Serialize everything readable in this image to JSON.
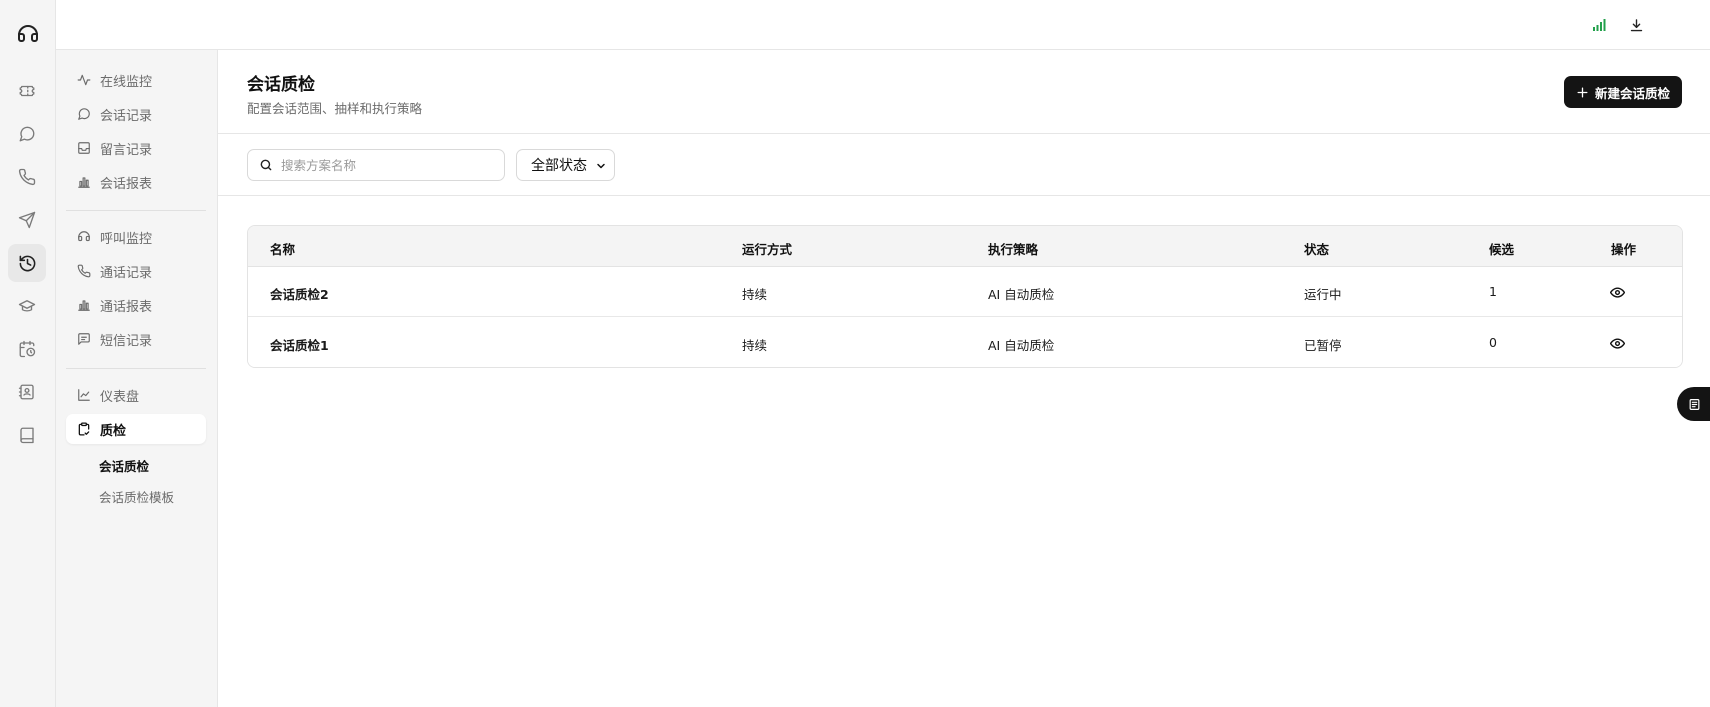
{
  "rail": {
    "logo_icon": "headset-icon",
    "items": [
      {
        "icon": "ticket-icon"
      },
      {
        "icon": "chat-bubble-icon"
      },
      {
        "icon": "phone-icon"
      },
      {
        "icon": "send-icon"
      },
      {
        "icon": "history-icon",
        "active": true
      },
      {
        "icon": "graduation-cap-icon"
      },
      {
        "icon": "calendar-clock-icon"
      },
      {
        "icon": "contact-book-icon"
      },
      {
        "icon": "book-icon"
      }
    ]
  },
  "topbar": {
    "icons": [
      "signal-icon",
      "download-icon"
    ],
    "signal_color": "#22a04b",
    "avatar": "sunglasses-emoji-avatar"
  },
  "subnav": {
    "groups": [
      {
        "items": [
          {
            "label": "在线监控",
            "icon": "pulse-icon"
          },
          {
            "label": "会话记录",
            "icon": "chat-bubble-icon"
          },
          {
            "label": "留言记录",
            "icon": "inbox-icon"
          },
          {
            "label": "会话报表",
            "icon": "bar-chart-icon"
          }
        ]
      },
      {
        "items": [
          {
            "label": "呼叫监控",
            "icon": "headset-icon"
          },
          {
            "label": "通话记录",
            "icon": "phone-icon"
          },
          {
            "label": "通话报表",
            "icon": "bar-chart-icon"
          },
          {
            "label": "短信记录",
            "icon": "message-square-icon"
          }
        ]
      },
      {
        "items": [
          {
            "label": "仪表盘",
            "icon": "line-chart-icon"
          },
          {
            "label": "质检",
            "icon": "clipboard-check-icon",
            "active": true
          }
        ]
      }
    ],
    "sub_items": [
      {
        "label": "会话质检",
        "active": true
      },
      {
        "label": "会话质检模板",
        "active": false
      }
    ]
  },
  "page": {
    "title": "会话质检",
    "subtitle": "配置会话范围、抽样和执行策略",
    "new_button": "新建会话质检"
  },
  "filters": {
    "search_placeholder": "搜索方案名称",
    "status_value": "全部状态"
  },
  "table": {
    "columns": [
      "名称",
      "运行方式",
      "执行策略",
      "状态",
      "候选",
      "操作"
    ],
    "rows": [
      {
        "name": "会话质检2",
        "mode": "持续",
        "strategy": "AI 自动质检",
        "status": "运行中",
        "candidates": "1",
        "action_icon": "eye-icon"
      },
      {
        "name": "会话质检1",
        "mode": "持续",
        "strategy": "AI 自动质检",
        "status": "已暂停",
        "candidates": "0",
        "action_icon": "eye-icon"
      }
    ]
  },
  "floating": {
    "icon": "book-icon"
  }
}
